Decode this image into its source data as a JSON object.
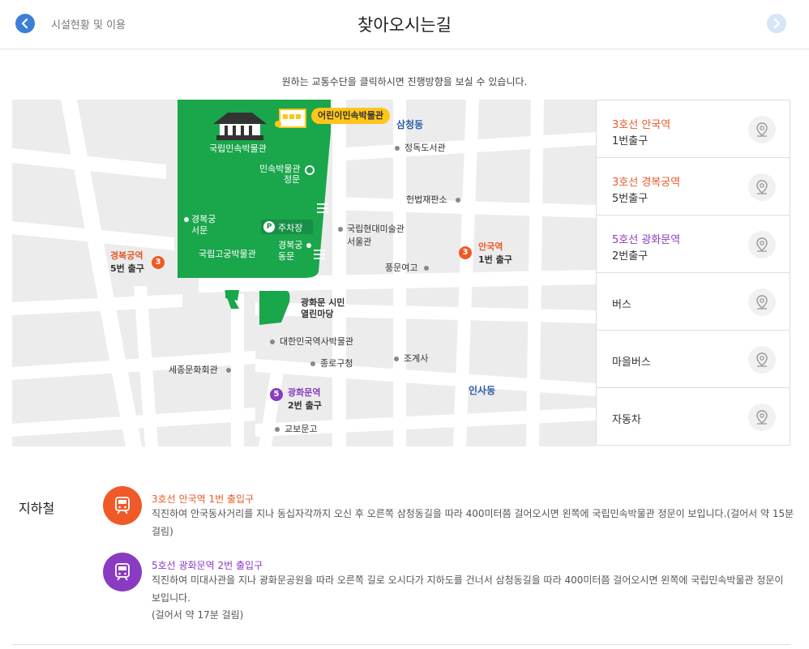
{
  "header": {
    "breadcrumb": "시설현황 및 이용",
    "title": "찾아오시는길"
  },
  "guide": "원하는 교통수단을 클릭하시면 진행방향을 보실 수 있습니다.",
  "map": {
    "museum_tag": "어린이민속박물관",
    "labels": {
      "folk_museum": "국립민속박물관",
      "samcheong": "삼청동",
      "jeongdok": "정독도서관",
      "main_gate_1": "민속박물관",
      "main_gate_2": "정문",
      "heonbeop": "헌법재판소",
      "west_gate_1": "경복궁",
      "west_gate_2": "서문",
      "parking": "주차장",
      "mmca_1": "국립현대미술관",
      "mmca_2": "서울관",
      "east_gate_1": "경복궁",
      "east_gate_2": "동문",
      "palace_museum": "국립고궁박물관",
      "gb_station": "경복궁역",
      "gb_exit": "5번 출구",
      "an_station": "안국역",
      "an_exit": "1번 출구",
      "pungmun": "풍문여고",
      "plaza_1": "광화문 시민",
      "plaza_2": "열린마당",
      "history_museum": "대한민국역사박물관",
      "sejong": "세종문화회관",
      "jongno": "종로구청",
      "jogyesa": "조계사",
      "insadong": "인사동",
      "gh_station": "광화문역",
      "gh_exit": "2번 출구",
      "kyobo": "교보문고"
    },
    "badges": {
      "line3": "3",
      "line5": "5",
      "parking": "P"
    }
  },
  "routes": [
    {
      "line": "3호선 안국역",
      "exit": "1번출구",
      "color": "#e85a2a"
    },
    {
      "line": "3호선 경복궁역",
      "exit": "5번출구",
      "color": "#e85a2a"
    },
    {
      "line": "5호선 광화문역",
      "exit": "2번출구",
      "color": "#8a3bc2"
    },
    {
      "label": "버스"
    },
    {
      "label": "마을버스"
    },
    {
      "label": "자동차"
    }
  ],
  "subway": {
    "title": "지하철",
    "items": [
      {
        "name": "3호선 안국역 1번 출입구",
        "desc1": "직진하여 안국동사거리를 지나 동십자각까지 오신 후 오른쪽 삼청동길을 따라 400미터쯤 걸어오시면 왼쪽에 국립민속박물관 정문이 보입니다.(걸어서 약 15분",
        "desc2": "걸림)",
        "color": "#e85a2a",
        "icon_color": "#ef5a28"
      },
      {
        "name": "5호선 광화문역 2번 출입구",
        "desc1": "직진하여 미대사관을 지나 광화문공원을 따라 오른쪽 길로 오시다가 지하도를 건너서 삼청동길을 따라 400미터쯤 걸어오시면 왼쪽에 국립민속박물관 정문이",
        "desc2": "보입니다.",
        "desc3": "(걸어서 약 17분 걸림)",
        "color": "#8a3bc2",
        "icon_color": "#8a3bc2"
      }
    ]
  }
}
